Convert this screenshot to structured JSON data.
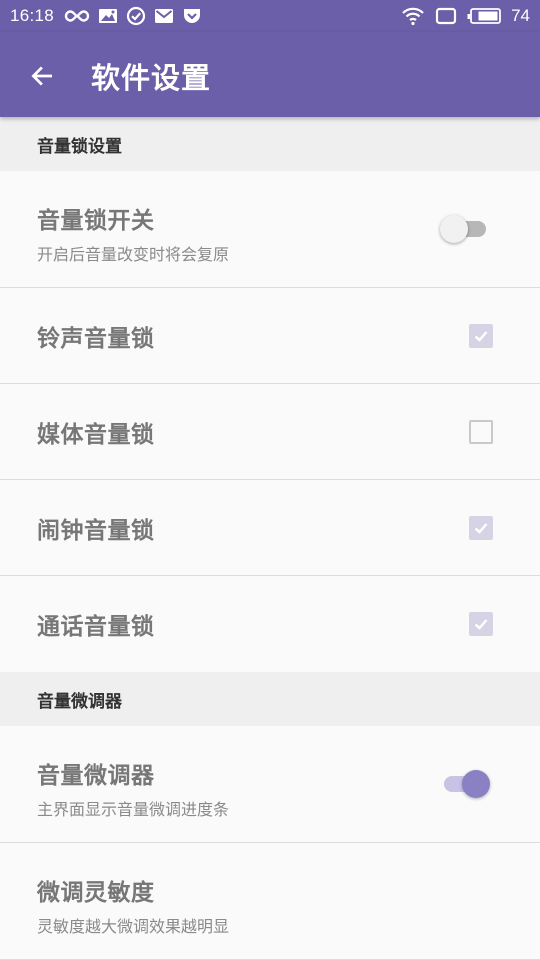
{
  "status_bar": {
    "time": "16:18",
    "battery_level": "74",
    "left_icons": [
      "infinity-icon",
      "image-mail-icon",
      "check-circle-icon",
      "mail-icon",
      "pocket-icon"
    ],
    "right_icons": [
      "wifi-icon",
      "screen-icon",
      "battery-icon"
    ]
  },
  "app_bar": {
    "title": "软件设置",
    "back_icon": "arrow-left-icon"
  },
  "sections": [
    {
      "header": "音量锁设置",
      "items": [
        {
          "title": "音量锁开关",
          "summary": "开启后音量改变时将会复原",
          "control": "switch",
          "checked": false
        },
        {
          "title": "铃声音量锁",
          "control": "checkbox",
          "checked": true
        },
        {
          "title": "媒体音量锁",
          "control": "checkbox",
          "checked": false
        },
        {
          "title": "闹钟音量锁",
          "control": "checkbox",
          "checked": true
        },
        {
          "title": "通话音量锁",
          "control": "checkbox",
          "checked": true
        }
      ]
    },
    {
      "header": "音量微调器",
      "items": [
        {
          "title": "音量微调器",
          "summary": "主界面显示音量微调进度条",
          "control": "switch",
          "checked": true
        },
        {
          "title": "微调灵敏度",
          "summary": "灵敏度越大微调效果越明显",
          "control": "none"
        }
      ]
    }
  ],
  "colors": {
    "primary": "#6a5fa8",
    "accent": "#8a80c4",
    "checkbox_checked": "#d6d4e4",
    "section_bg": "#efefef",
    "background": "#fafafa"
  }
}
